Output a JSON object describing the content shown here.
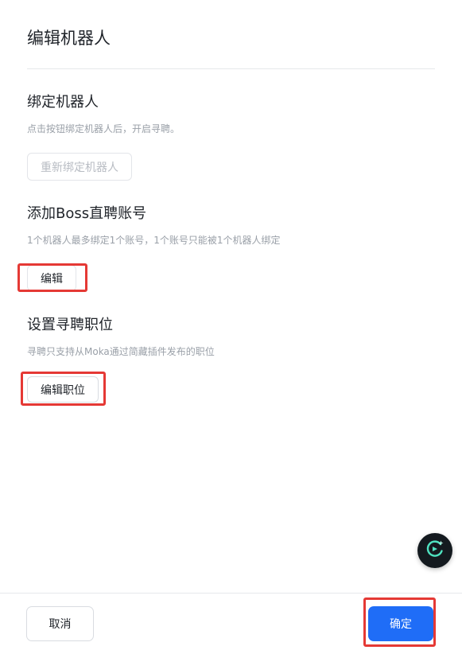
{
  "header": {
    "title": "编辑机器人"
  },
  "sections": {
    "bind": {
      "title": "绑定机器人",
      "desc": "点击按钮绑定机器人后，开启寻聘。",
      "button_label": "重新绑定机器人"
    },
    "boss": {
      "title": "添加Boss直聘账号",
      "desc": "1个机器人最多绑定1个账号，1个账号只能被1个机器人绑定",
      "button_label": "编辑"
    },
    "position": {
      "title": "设置寻聘职位",
      "desc": "寻聘只支持从Moka通过简藏插件发布的职位",
      "button_label": "编辑职位"
    }
  },
  "footer": {
    "cancel_label": "取消",
    "ok_label": "确定"
  },
  "icons": {
    "floating_assistant": "ai-assistant-icon"
  },
  "colors": {
    "primary": "#1f6df7",
    "highlight": "#e53935",
    "assistant_bg": "#141a1f",
    "assistant_accent": "#4fe3c1"
  }
}
